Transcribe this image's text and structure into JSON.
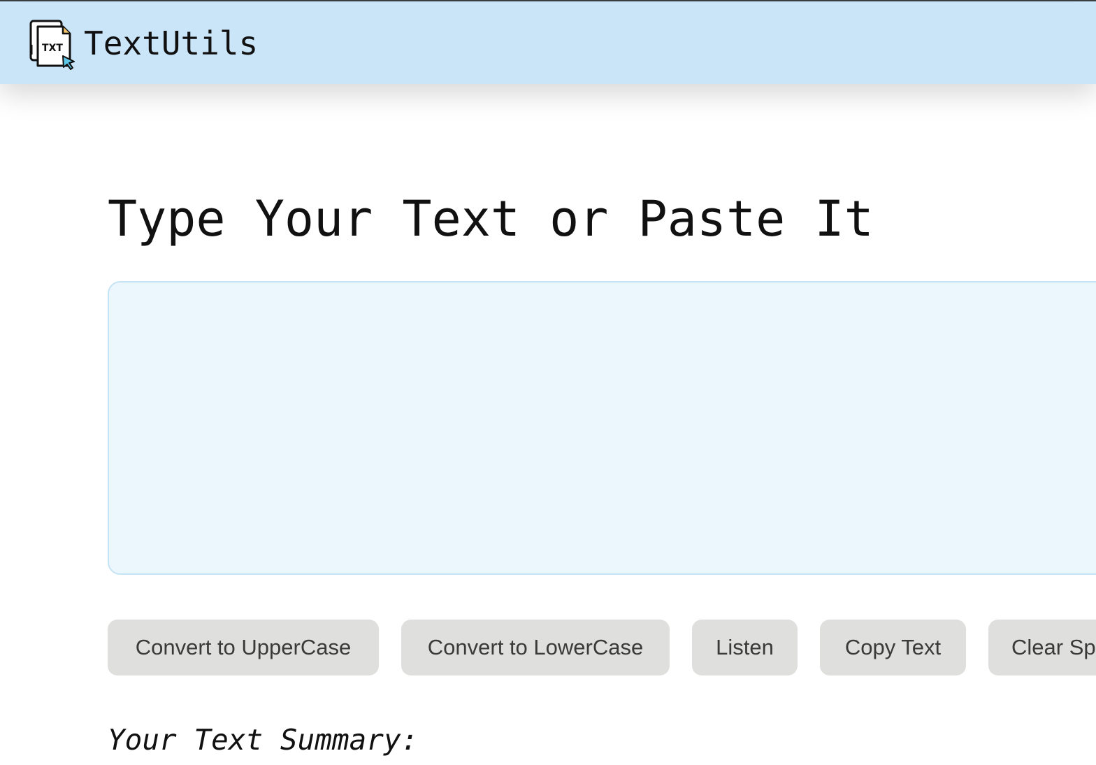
{
  "navbar": {
    "brand_name": "TextUtils",
    "logo_icon": "txt-file-cursor-icon",
    "logo_text": "TXT",
    "background": "#cae4f8"
  },
  "main": {
    "title": "Type Your Text or Paste It",
    "textarea": {
      "value": "",
      "background": "#ecf7fd"
    },
    "buttons": [
      {
        "label": "Convert to UpperCase"
      },
      {
        "label": "Convert to LowerCase"
      },
      {
        "label": "Listen"
      },
      {
        "label": "Copy Text"
      },
      {
        "label": "Clear Sp"
      }
    ],
    "button_color": "#dfe0dd",
    "summary_heading": "Your Text Summary:"
  }
}
